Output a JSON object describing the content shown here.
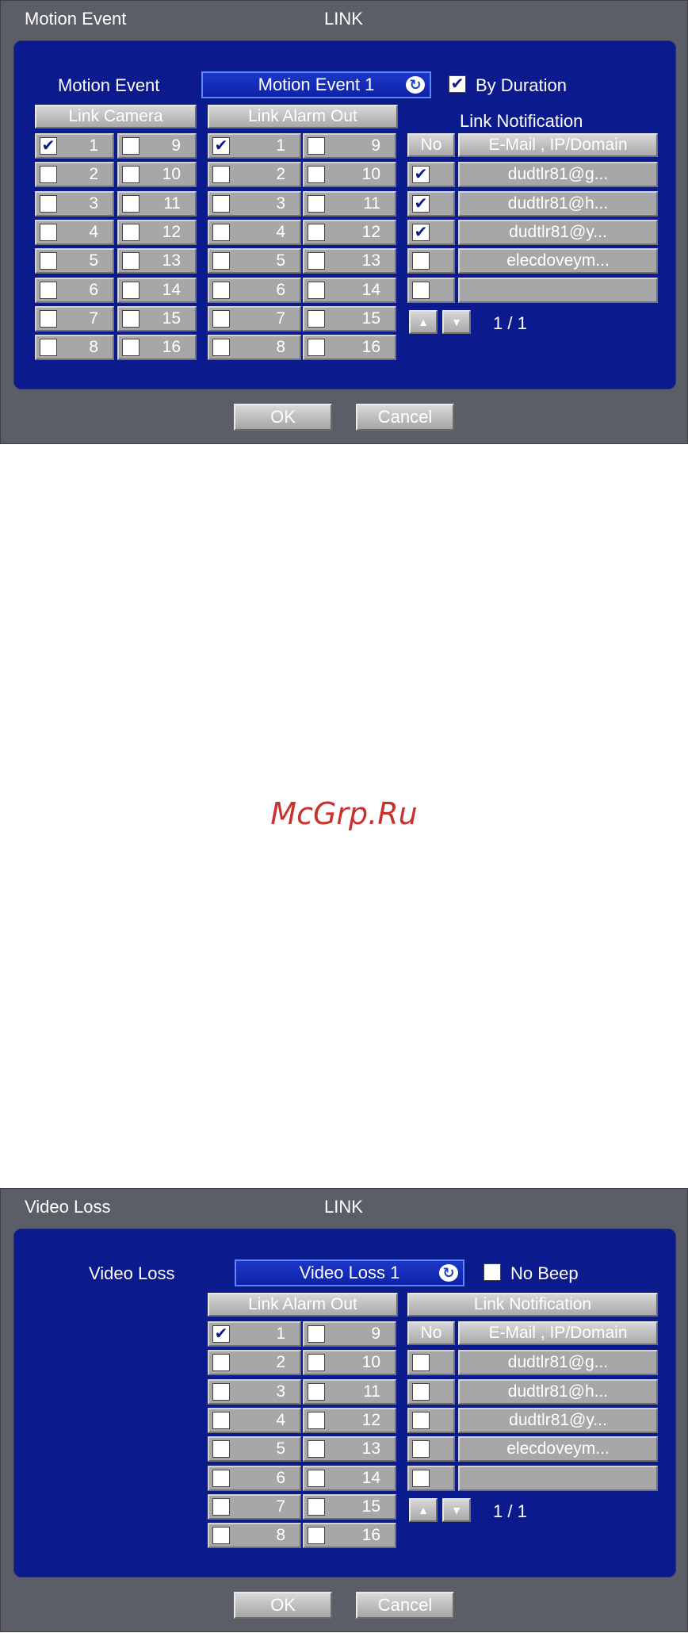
{
  "dialog1": {
    "title_left": "Motion Event",
    "title_center": "LINK",
    "event_label": "Motion Event",
    "event_value": "Motion Event 1",
    "option_label": "By Duration",
    "option_checked": true,
    "link_camera": "Link Camera",
    "link_alarm_out": "Link Alarm Out",
    "link_notification": "Link Notification",
    "col_no": "No",
    "col_email": "E-Mail , IP/Domain",
    "camera_checked": [
      1
    ],
    "alarm_checked": [
      1
    ],
    "notifications": [
      {
        "address": "dudtlr81@g...",
        "checked": true
      },
      {
        "address": "dudtlr81@h...",
        "checked": true
      },
      {
        "address": "dudtlr81@y...",
        "checked": true
      },
      {
        "address": "elecdoveym...",
        "checked": false
      },
      {
        "address": "",
        "checked": false
      }
    ],
    "page": "1 / 1",
    "ok": "OK",
    "cancel": "Cancel"
  },
  "dialog2": {
    "title_left": "Video Loss",
    "title_center": "LINK",
    "event_label": "Video Loss",
    "event_value": "Video Loss 1",
    "option_label": "No Beep",
    "option_checked": false,
    "link_alarm_out": "Link Alarm Out",
    "link_notification": "Link Notification",
    "col_no": "No",
    "col_email": "E-Mail , IP/Domain",
    "alarm_checked": [
      1
    ],
    "notifications": [
      {
        "address": "dudtlr81@g...",
        "checked": false
      },
      {
        "address": "dudtlr81@h...",
        "checked": false
      },
      {
        "address": "dudtlr81@y...",
        "checked": false
      },
      {
        "address": "elecdoveym...",
        "checked": false
      },
      {
        "address": "",
        "checked": false
      }
    ],
    "page": "1 / 1",
    "ok": "OK",
    "cancel": "Cancel"
  },
  "numbers_left": [
    "1",
    "2",
    "3",
    "4",
    "5",
    "6",
    "7",
    "8"
  ],
  "numbers_right": [
    "9",
    "10",
    "11",
    "12",
    "13",
    "14",
    "15",
    "16"
  ],
  "check_glyph": "✔",
  "refresh_glyph": "↻",
  "arrow_up_glyph": "▲",
  "arrow_down_glyph": "▼",
  "watermark": "McGrp.Ru",
  "colors": {
    "panel": "#0b1a8c",
    "frame": "#5b5e66",
    "combo": "#1c38c8",
    "watermark": "#c8322f"
  }
}
